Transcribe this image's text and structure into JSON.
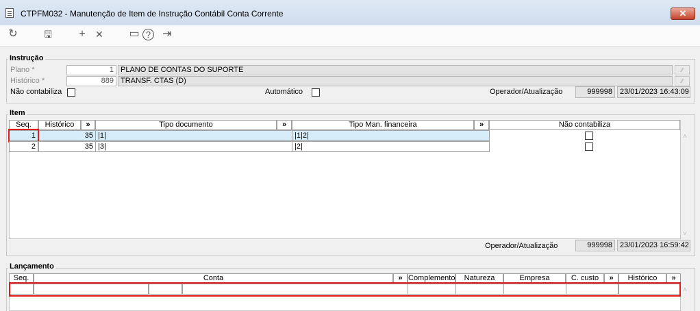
{
  "window": {
    "title": "CTPFM032 - Manutenção de Item de Instrução Contábil Conta Corrente",
    "close_glyph": "✕"
  },
  "toolbar": {
    "refresh_glyph": "↻",
    "save_glyph": "🖫",
    "add_glyph": "+",
    "delete_glyph": "✕",
    "calendar_glyph": "▭",
    "help_glyph": "?",
    "exit_glyph": "⇥"
  },
  "instrucao": {
    "legend": "Instrução",
    "plano_label": "Plano *",
    "plano_value": "1",
    "plano_desc": "PLANO DE CONTAS DO SUPORTE",
    "historico_label": "Histórico *",
    "historico_value": "889",
    "historico_desc": "TRANSF. CTAS (D)",
    "nao_contabiliza_label": "Não contabiliza",
    "automatico_label": "Automático",
    "operador_label": "Operador/Atualização",
    "operador_value": "999998",
    "atualizacao_value": "23/01/2023 16:43:09"
  },
  "item": {
    "legend": "Item",
    "columns": {
      "seq": "Seq.",
      "historico": "Histórico",
      "expand1": "»",
      "tipo_documento": "Tipo documento",
      "expand2": "»",
      "tipo_man_financeira": "Tipo Man. financeira",
      "expand3": "»",
      "nao_contabiliza": "Não contabiliza"
    },
    "rows": [
      {
        "seq": "1",
        "historico": "35",
        "tipo_documento": "|1|",
        "tipo_man_financeira": "|1|2|"
      },
      {
        "seq": "2",
        "historico": "35",
        "tipo_documento": "|3|",
        "tipo_man_financeira": "|2|"
      }
    ],
    "operador_label": "Operador/Atualização",
    "operador_value": "999998",
    "atualizacao_value": "23/01/2023 16:59:42"
  },
  "lancamento": {
    "legend": "Lançamento",
    "columns": {
      "seq": "Seq.",
      "conta": "Conta",
      "expand1": "»",
      "complemento": "Complemento",
      "natureza": "Natureza",
      "empresa": "Empresa",
      "c_custo": "C. custo",
      "expand2": "»",
      "historico": "Histórico",
      "expand3": "»"
    }
  },
  "scroll": {
    "up": "˄",
    "down": "˅"
  }
}
